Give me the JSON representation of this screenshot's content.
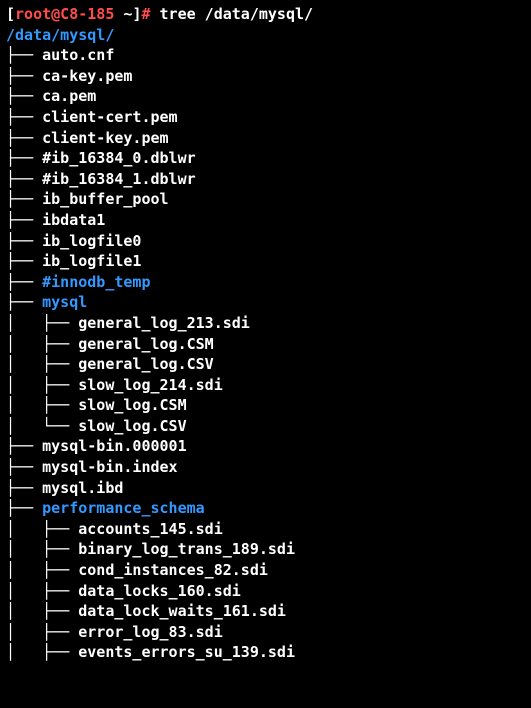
{
  "prompt": {
    "open_bracket": "[",
    "user_host": "root@C8-185",
    "space": " ",
    "cwd": "~",
    "close_bracket": "]",
    "hash": "# ",
    "command": "tree /data/mysql/"
  },
  "root_path": "/data/mysql/",
  "tree_lines": [
    {
      "prefix": "├── ",
      "name": "auto.cnf",
      "dir": false,
      "indent": 0
    },
    {
      "prefix": "├── ",
      "name": "ca-key.pem",
      "dir": false,
      "indent": 0
    },
    {
      "prefix": "├── ",
      "name": "ca.pem",
      "dir": false,
      "indent": 0
    },
    {
      "prefix": "├── ",
      "name": "client-cert.pem",
      "dir": false,
      "indent": 0
    },
    {
      "prefix": "├── ",
      "name": "client-key.pem",
      "dir": false,
      "indent": 0
    },
    {
      "prefix": "├── ",
      "name": "#ib_16384_0.dblwr",
      "dir": false,
      "indent": 0
    },
    {
      "prefix": "├── ",
      "name": "#ib_16384_1.dblwr",
      "dir": false,
      "indent": 0
    },
    {
      "prefix": "├── ",
      "name": "ib_buffer_pool",
      "dir": false,
      "indent": 0
    },
    {
      "prefix": "├── ",
      "name": "ibdata1",
      "dir": false,
      "indent": 0
    },
    {
      "prefix": "├── ",
      "name": "ib_logfile0",
      "dir": false,
      "indent": 0
    },
    {
      "prefix": "├── ",
      "name": "ib_logfile1",
      "dir": false,
      "indent": 0
    },
    {
      "prefix": "├── ",
      "name": "#innodb_temp",
      "dir": true,
      "indent": 0
    },
    {
      "prefix": "├── ",
      "name": "mysql",
      "dir": true,
      "indent": 0
    },
    {
      "prefix": "│   ├── ",
      "name": "general_log_213.sdi",
      "dir": false,
      "indent": 1
    },
    {
      "prefix": "│   ├── ",
      "name": "general_log.CSM",
      "dir": false,
      "indent": 1
    },
    {
      "prefix": "│   ├── ",
      "name": "general_log.CSV",
      "dir": false,
      "indent": 1
    },
    {
      "prefix": "│   ├── ",
      "name": "slow_log_214.sdi",
      "dir": false,
      "indent": 1
    },
    {
      "prefix": "│   ├── ",
      "name": "slow_log.CSM",
      "dir": false,
      "indent": 1
    },
    {
      "prefix": "│   └── ",
      "name": "slow_log.CSV",
      "dir": false,
      "indent": 1
    },
    {
      "prefix": "├── ",
      "name": "mysql-bin.000001",
      "dir": false,
      "indent": 0
    },
    {
      "prefix": "├── ",
      "name": "mysql-bin.index",
      "dir": false,
      "indent": 0
    },
    {
      "prefix": "├── ",
      "name": "mysql.ibd",
      "dir": false,
      "indent": 0
    },
    {
      "prefix": "├── ",
      "name": "performance_schema",
      "dir": true,
      "indent": 0
    },
    {
      "prefix": "│   ├── ",
      "name": "accounts_145.sdi",
      "dir": false,
      "indent": 1
    },
    {
      "prefix": "│   ├── ",
      "name": "binary_log_trans_189.sdi",
      "dir": false,
      "indent": 1
    },
    {
      "prefix": "│   ├── ",
      "name": "cond_instances_82.sdi",
      "dir": false,
      "indent": 1
    },
    {
      "prefix": "│   ├── ",
      "name": "data_locks_160.sdi",
      "dir": false,
      "indent": 1
    },
    {
      "prefix": "│   ├── ",
      "name": "data_lock_waits_161.sdi",
      "dir": false,
      "indent": 1
    },
    {
      "prefix": "│   ├── ",
      "name": "error_log_83.sdi",
      "dir": false,
      "indent": 1
    },
    {
      "prefix": "│   ├── ",
      "name": "events_errors_su_139.sdi",
      "dir": false,
      "indent": 1
    }
  ]
}
